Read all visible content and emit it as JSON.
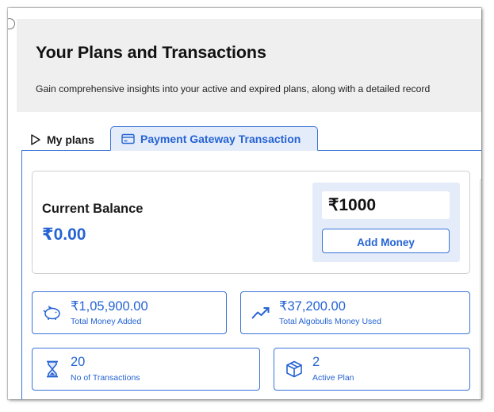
{
  "header": {
    "title": "Your Plans and Transactions",
    "subtitle": "Gain comprehensive insights into your active and expired plans, along with a detailed record"
  },
  "tabs": [
    {
      "label": "My plans",
      "icon": "play-outline-icon",
      "active": false
    },
    {
      "label": "Payment Gateway Transaction",
      "icon": "card-icon",
      "active": true
    }
  ],
  "balance": {
    "label": "Current Balance",
    "value": "₹0.00",
    "amount_input": "₹1000",
    "add_money_label": "Add Money"
  },
  "stats": [
    {
      "value": "₹1,05,900.00",
      "label": "Total Money Added",
      "icon": "piggy-bank-icon"
    },
    {
      "value": "₹37,200.00",
      "label": "Total Algobulls Money Used",
      "icon": "trending-up-icon"
    },
    {
      "value": "20",
      "label": "No of Transactions",
      "icon": "hourglass-icon"
    },
    {
      "value": "2",
      "label": "Active Plan",
      "icon": "package-icon"
    }
  ],
  "colors": {
    "accent": "#2563d4",
    "accent_border": "#3a74d8",
    "tab_bg": "#e4ecf9",
    "header_bg": "#efefef"
  }
}
